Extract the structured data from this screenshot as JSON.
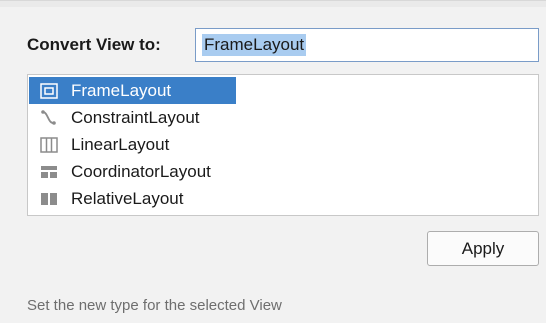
{
  "dialog": {
    "convert_label": "Convert View to:",
    "input_value": "FrameLayout",
    "apply_label": "Apply",
    "hint": "Set the new type for the selected View"
  },
  "layout_types": [
    {
      "label": "FrameLayout",
      "icon": "frame-layout-icon",
      "selected": true
    },
    {
      "label": "ConstraintLayout",
      "icon": "constraint-layout-icon",
      "selected": false
    },
    {
      "label": "LinearLayout",
      "icon": "linear-layout-icon",
      "selected": false
    },
    {
      "label": "CoordinatorLayout",
      "icon": "coordinator-layout-icon",
      "selected": false
    },
    {
      "label": "RelativeLayout",
      "icon": "relative-layout-icon",
      "selected": false
    }
  ],
  "colors": {
    "selection": "#3a7fc8",
    "input_highlight": "#a9ccf0",
    "icon_gray": "#8c8c8c"
  }
}
